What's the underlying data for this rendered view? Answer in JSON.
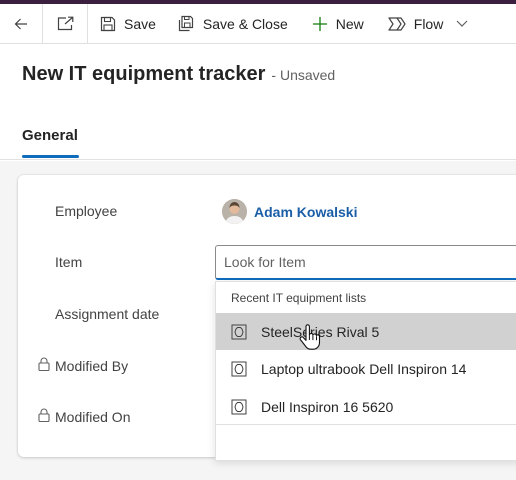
{
  "commandbar": {
    "save_label": "Save",
    "save_close_label": "Save & Close",
    "new_label": "New",
    "flow_label": "Flow"
  },
  "header": {
    "title": "New IT equipment tracker",
    "status": "- Unsaved"
  },
  "tabs": [
    {
      "label": "General"
    }
  ],
  "form": {
    "employee_label": "Employee",
    "employee_value": "Adam Kowalski",
    "item_label": "Item",
    "item_placeholder": "Look for Item",
    "assignment_date_label": "Assignment date",
    "modified_by_label": "Modified By",
    "modified_on_label": "Modified On"
  },
  "lookup_dropdown": {
    "header": "Recent IT equipment lists",
    "items": [
      {
        "label": "SteelSeries Rival 5"
      },
      {
        "label": "Laptop ultrabook Dell Inspiron 14"
      },
      {
        "label": "Dell Inspiron 16 5620"
      }
    ]
  },
  "colors": {
    "accent": "#0f6cbd",
    "link": "#1a5ea8",
    "top_bar": "#3b1f3f",
    "hover_row": "#d1d1d1"
  },
  "icons": {
    "back": "arrow-left-icon",
    "popout": "open-in-new-window-icon",
    "save": "floppy-disk-icon",
    "save_close": "save-and-close-icon",
    "new": "plus-icon",
    "flow": "power-automate-flow-icon",
    "flow_menu": "chevron-down-icon",
    "lock": "lock-icon",
    "item": "equipment-entity-icon"
  }
}
